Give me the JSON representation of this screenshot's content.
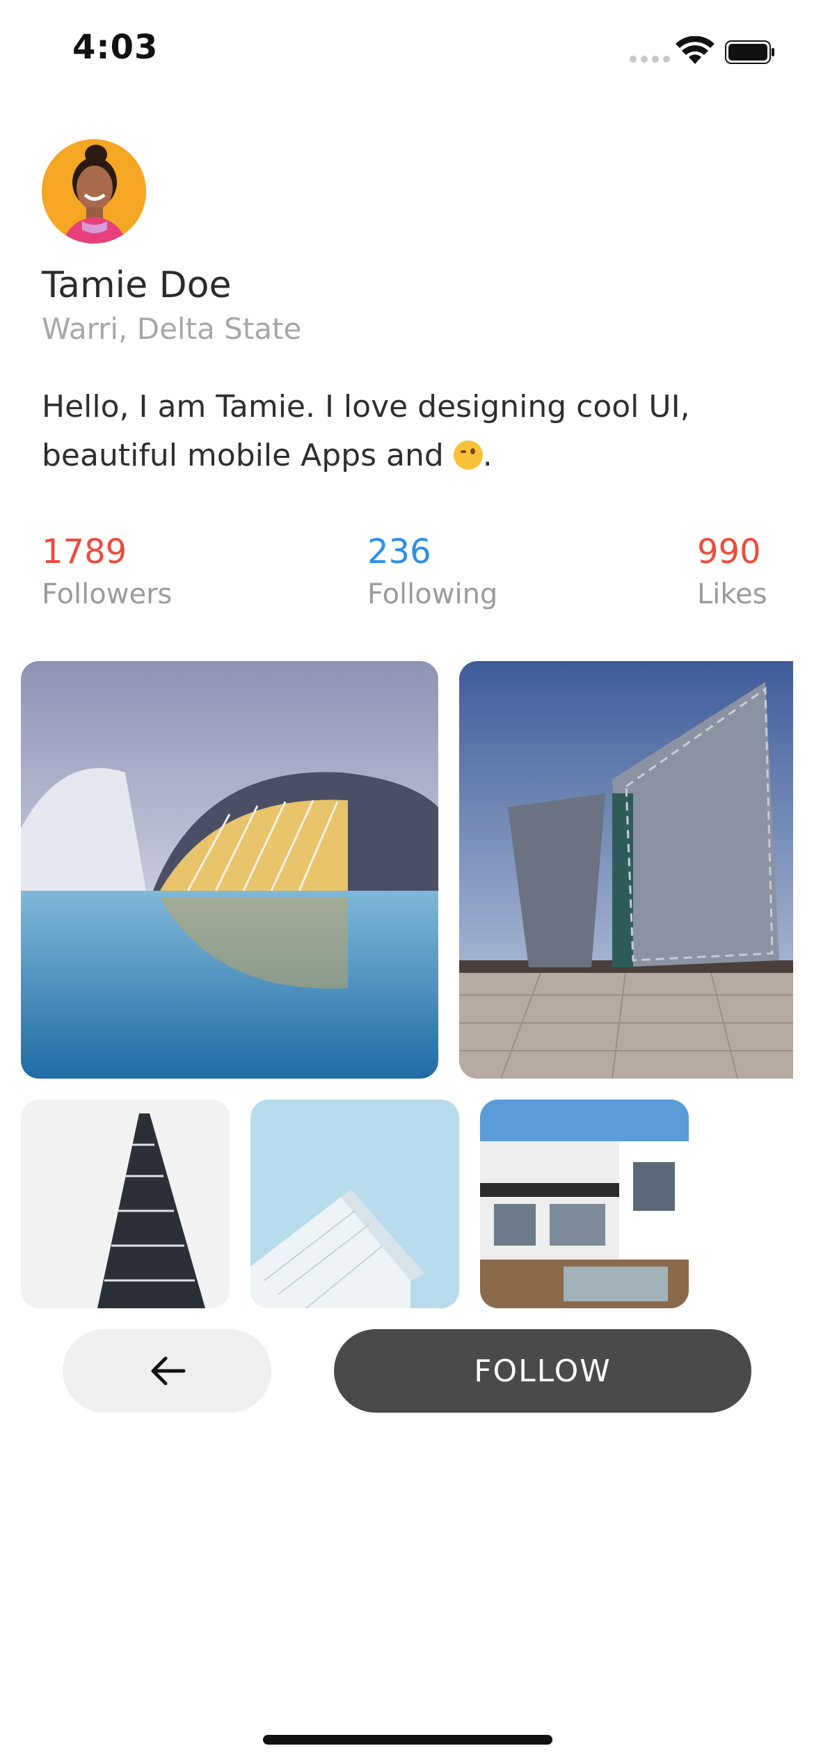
{
  "status_bar": {
    "time": "4:03"
  },
  "profile": {
    "name": "Tamie Doe",
    "location": "Warri, Delta State",
    "bio": "Hello, I am Tamie. I love designing cool UI, beautiful mobile Apps and",
    "bio_end": ".",
    "bio_emoji_icon": "winking-face-icon"
  },
  "stats": [
    {
      "value": "1789",
      "label": "Followers",
      "color": "#ef4a3c"
    },
    {
      "value": "236",
      "label": "Following",
      "color": "#2b8fe8"
    },
    {
      "value": "990",
      "label": "Likes",
      "color": "#ef4a3c"
    }
  ],
  "actions": {
    "back_icon": "arrow-left-icon",
    "follow_label": "FOLLOW"
  },
  "colors": {
    "avatar_bg": "#f5a623",
    "follow_button_bg": "#4a4a4a",
    "back_button_bg": "#efefef"
  }
}
